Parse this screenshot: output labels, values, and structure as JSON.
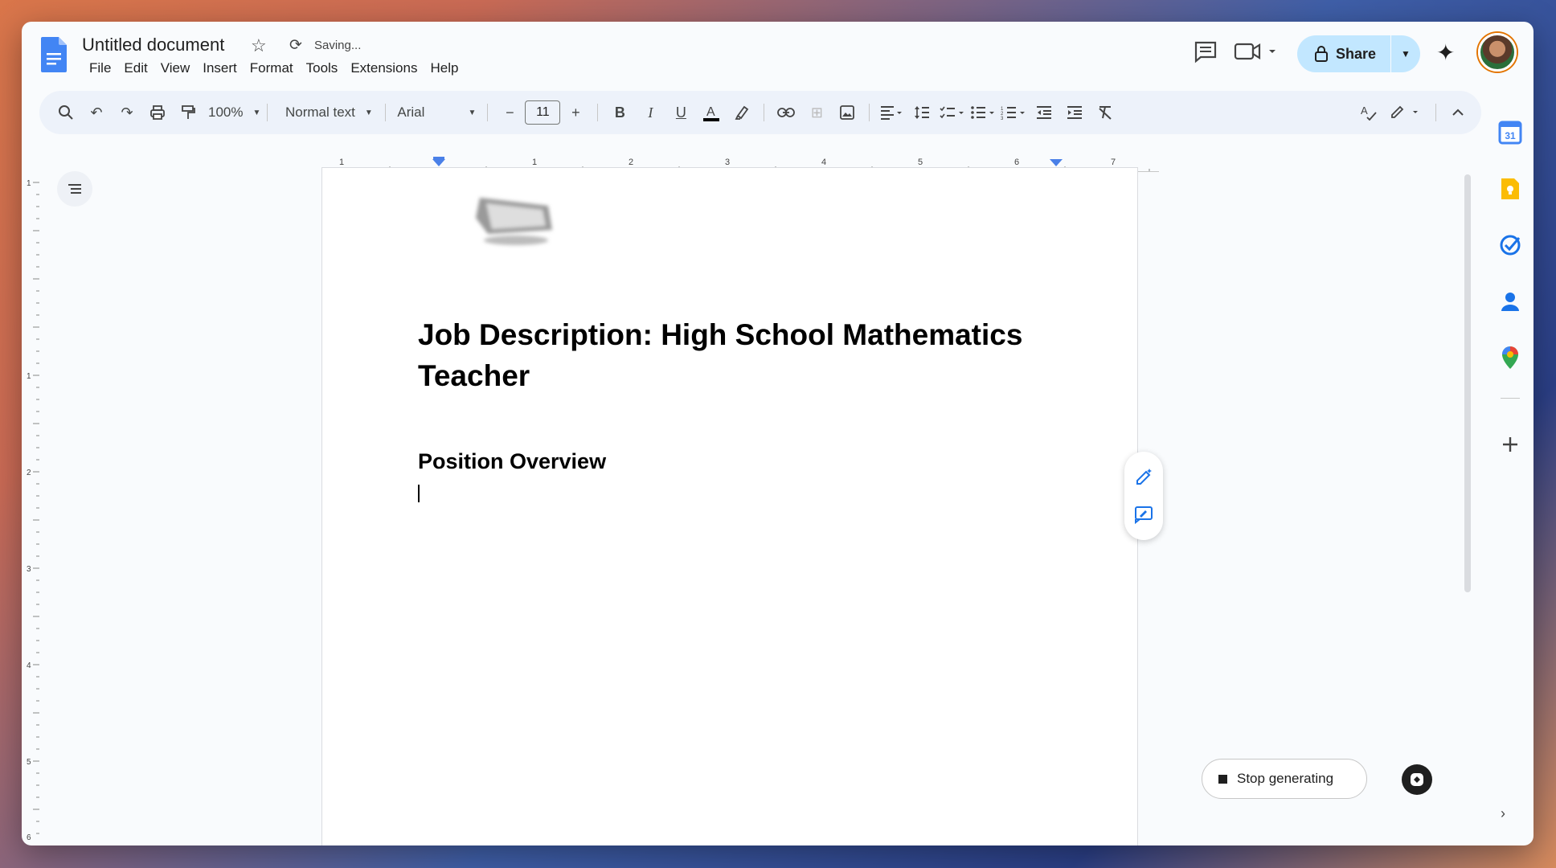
{
  "document": {
    "title": "Untitled document",
    "status": "Saving...",
    "heading1": "Job Description: High School Mathematics Teacher",
    "heading2": "Position Overview"
  },
  "menu": [
    "File",
    "Edit",
    "View",
    "Insert",
    "Format",
    "Tools",
    "Extensions",
    "Help"
  ],
  "share": {
    "label": "Share"
  },
  "toolbar": {
    "zoom": "100%",
    "style": "Normal text",
    "font": "Arial",
    "font_size": "11"
  },
  "ruler": {
    "h_labels": [
      "1",
      "1",
      "2",
      "3",
      "4",
      "5",
      "6",
      "7"
    ],
    "v_labels": [
      "1",
      "1",
      "2",
      "3",
      "4",
      "5",
      "6"
    ]
  },
  "actions": {
    "stop_generating": "Stop generating"
  },
  "icons": {
    "docs_logo": "docs-logo-icon",
    "star": "star-icon",
    "sync": "sync-icon",
    "comments": "comment-icon",
    "meet": "video-camera-icon",
    "lock": "lock-icon",
    "gemini": "sparkle-icon"
  },
  "colors": {
    "accent": "#1a73e8",
    "share_bg": "#c2e7ff",
    "toolbar_bg": "#edf2fa"
  }
}
